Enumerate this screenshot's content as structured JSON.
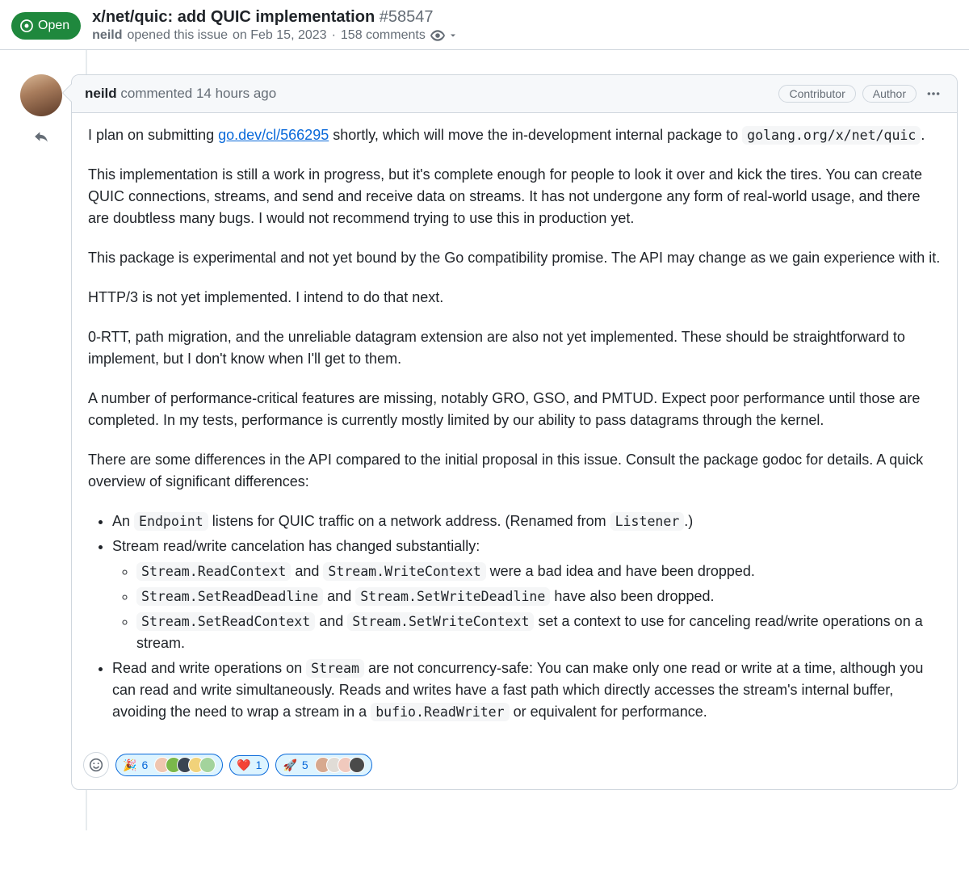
{
  "header": {
    "state": "Open",
    "title": "x/net/quic: add QUIC implementation",
    "issue_number": "#58547",
    "author": "neild",
    "opened_text": "opened this issue",
    "opened_date": "on Feb 15, 2023",
    "comments_count": "158 comments"
  },
  "comment": {
    "author": "neild",
    "commented_text": "commented",
    "timestamp": "14 hours ago",
    "badges": [
      "Contributor",
      "Author"
    ],
    "p1_a": "I plan on submitting ",
    "p1_link": "go.dev/cl/566295",
    "p1_b": " shortly, which will move the in-development internal package to ",
    "p1_code": "golang.org/x/net/quic",
    "p1_c": ".",
    "p2": "This implementation is still a work in progress, but it's complete enough for people to look it over and kick the tires. You can create QUIC connections, streams, and send and receive data on streams. It has not undergone any form of real-world usage, and there are doubtless many bugs. I would not recommend trying to use this in production yet.",
    "p3": "This package is experimental and not yet bound by the Go compatibility promise. The API may change as we gain experience with it.",
    "p4": "HTTP/3 is not yet implemented. I intend to do that next.",
    "p5": "0-RTT, path migration, and the unreliable datagram extension are also not yet implemented. These should be straightforward to implement, but I don't know when I'll get to them.",
    "p6": "A number of performance-critical features are missing, notably GRO, GSO, and PMTUD. Expect poor performance until those are completed. In my tests, performance is currently mostly limited by our ability to pass datagrams through the kernel.",
    "p7": "There are some differences in the API compared to the initial proposal in this issue. Consult the package godoc for details. A quick overview of significant differences:",
    "li1_a": "An ",
    "li1_code1": "Endpoint",
    "li1_b": " listens for QUIC traffic on a network address. (Renamed from ",
    "li1_code2": "Listener",
    "li1_c": ".)",
    "li2": "Stream read/write cancelation has changed substantially:",
    "li2a_code1": "Stream.ReadContext",
    "li2a_mid": " and ",
    "li2a_code2": "Stream.WriteContext",
    "li2a_end": " were a bad idea and have been dropped.",
    "li2b_code1": "Stream.SetReadDeadline",
    "li2b_mid": " and ",
    "li2b_code2": "Stream.SetWriteDeadline",
    "li2b_end": " have also been dropped.",
    "li2c_code1": "Stream.SetReadContext",
    "li2c_mid": " and ",
    "li2c_code2": "Stream.SetWriteContext",
    "li2c_end": " set a context to use for canceling read/write operations on a stream.",
    "li3_a": "Read and write operations on ",
    "li3_code1": "Stream",
    "li3_b": " are not concurrency-safe: You can make only one read or write at a time, although you can read and write simultaneously. Reads and writes have a fast path which directly accesses the stream's internal buffer, avoiding the need to wrap a stream in a ",
    "li3_code2": "bufio.ReadWriter",
    "li3_c": " or equivalent for performance."
  },
  "reactions": {
    "tada": {
      "emoji": "🎉",
      "count": "6",
      "reactors": [
        "#efc6b0",
        "#7ab84a",
        "#3a4552",
        "#f1d27a",
        "#a3d39c"
      ]
    },
    "heart": {
      "emoji": "❤️",
      "count": "1"
    },
    "rocket": {
      "emoji": "🚀",
      "count": "5",
      "reactors": [
        "#d7a98f",
        "#e0dcd6",
        "#f0c9bd",
        "#4a4a4a"
      ]
    }
  }
}
